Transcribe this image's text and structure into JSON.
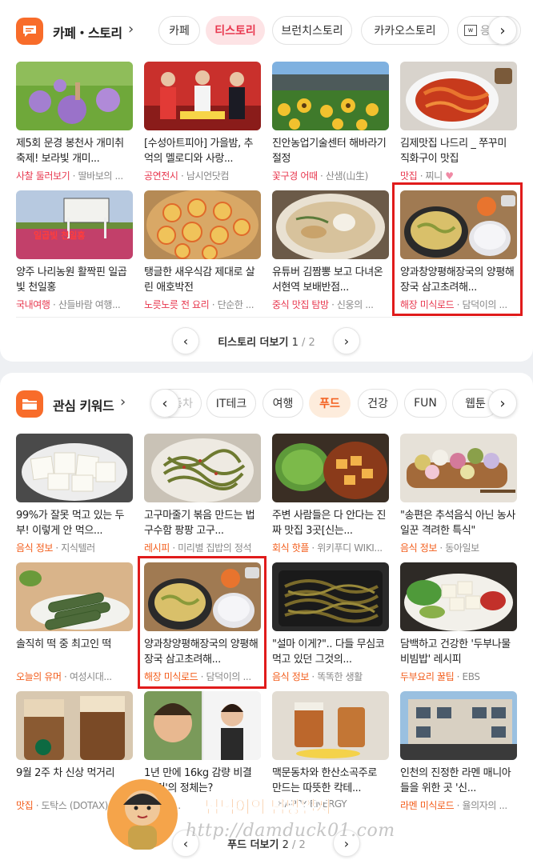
{
  "section1": {
    "title": "카페・스토리",
    "chips": [
      "카페",
      "티스토리",
      "브런치스토리",
      "카카오스토리",
      "응"
    ],
    "active_chip_index": 1,
    "items": [
      {
        "title": "제5회 문경 봉천사 개미취 축제! 보라빛 개미...",
        "tag": "사찰 둘러보기",
        "source": "딸바보의 ..."
      },
      {
        "title": "[수성아트피아] 가을밤, 추억의 멜로디와 사랑...",
        "tag": "공연전시",
        "source": "남시언닷컴"
      },
      {
        "title": "진안농업기술센터 해바라기 절정",
        "tag": "꽃구경 어때",
        "source": "산샘(山生)"
      },
      {
        "title": "김제맛집 나드리 _ 쭈꾸미 직화구이 맛집",
        "tag": "맛집",
        "source": "찌니"
      },
      {
        "title": "양주 나리농원 활짝핀 일곱 빛 천일홍",
        "tag": "국내여행",
        "source": "산들바람 여행..."
      },
      {
        "title": "탱글한 새우식감 제대로 살린 애호박전",
        "tag": "노릇노릇 전 요리",
        "source": "단순한 ..."
      },
      {
        "title": "유튜버 김짬뽕 보고 다녀온 서현역 보배반점...",
        "tag": "중식 맛집 탐방",
        "source": "신웅의 ..."
      },
      {
        "title": "양과창양평해장국의 양평해장국 삼고초려해...",
        "tag": "해장 미식로드",
        "source": "담덕이의 ..."
      }
    ],
    "pager": {
      "label": "티스토리 더보기",
      "current": "1",
      "total": "/ 2"
    }
  },
  "section2": {
    "title": "관심 키워드",
    "chips": [
      "동차",
      "IT테크",
      "여행",
      "푸드",
      "건강",
      "FUN",
      "웹툰"
    ],
    "active_chip_index": 3,
    "items": [
      {
        "title": "99%가 잘못 먹고 있는 두부! 이렇게 안 먹으...",
        "tag": "음식 정보",
        "source": "지식텔러"
      },
      {
        "title": "고구마줄기 볶음 만드는 법 구수함 팡팡 고구...",
        "tag": "레시피",
        "source": "미리별 집밥의 정석"
      },
      {
        "title": "주변 사람들은 다 안다는 진짜 맛집 3곳[신는...",
        "tag": "회식 핫플",
        "source": "위키푸디 WIKI..."
      },
      {
        "title": "\"송편은 추석음식 아닌 농사일꾼 격려한 특식\"",
        "tag": "음식 정보",
        "source": "동아일보"
      },
      {
        "title": "솔직히 떡 중 최고인 떡",
        "tag": "오늘의 유머",
        "source": "여성시대..."
      },
      {
        "title": "양과창양평해장국의 양평해장국 삼고초려해...",
        "tag": "해장 미식로드",
        "source": "담덕이의 ..."
      },
      {
        "title": "\"설마 이게?\".. 다들 무심코 먹고 있던 그것의...",
        "tag": "음식 정보",
        "source": "똑똑한 생활"
      },
      {
        "title": "담백하고 건강한 '두부나물 비빔밥' 레시피",
        "tag": "두부요리 꿀팁",
        "source": "EBS"
      },
      {
        "title": "9월 2주 차 신상 먹거리",
        "tag": "맛집",
        "source": "도탁스 (DOTAX)"
      },
      {
        "title": "1년 만에 16kg 감량 비결 '이것'의 정체는?",
        "tag": "",
        "source": "1일 1..."
      },
      {
        "title": "맥문동차와 한산소곡주로 만드는 따뜻한 칵테...",
        "tag": "",
        "source": "HAPPY ENERGY"
      },
      {
        "title": "인천의 진정한 라멘 매니아들을 위한 곳 '신...",
        "tag": "라멘 미식로드",
        "source": "율의자의 ..."
      }
    ],
    "pager": {
      "label": "푸드 더보기",
      "current": "2",
      "total": "/ 2"
    }
  },
  "watermark": {
    "name": "담덕이의 탐방일지",
    "url": "http://damduck01.com"
  },
  "colors": {
    "accent_red": "#e8384f",
    "accent_orange": "#f35d1b",
    "highlight_box": "#e01b1b",
    "logo": "#f86c2a"
  }
}
